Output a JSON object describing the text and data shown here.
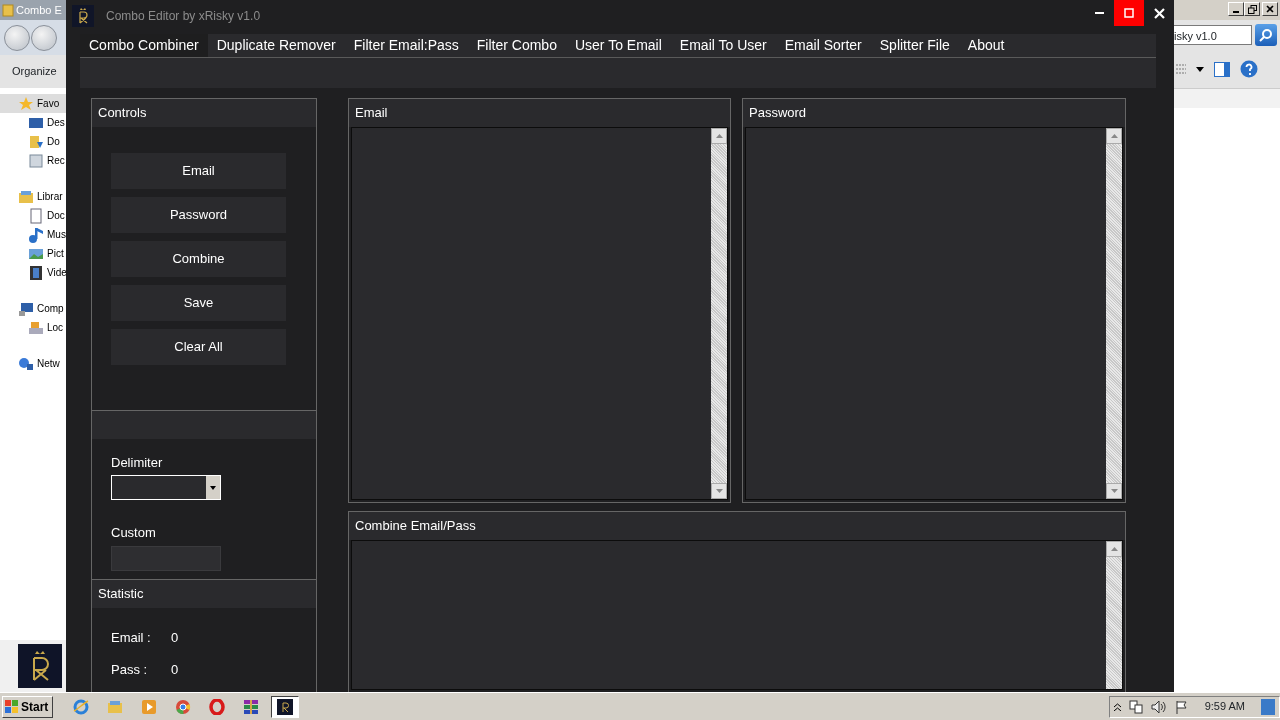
{
  "explorer": {
    "title": "Combo E",
    "toolbar": "Organize",
    "search_value": "isky v1.0",
    "sidebar": [
      {
        "label": "Favo",
        "selected": true,
        "children": [
          {
            "label": "Des",
            "selected": false
          },
          {
            "label": "Do",
            "selected": false
          },
          {
            "label": "Rec",
            "selected": false
          }
        ]
      },
      {
        "label": "Librar",
        "selected": false,
        "children": [
          {
            "label": "Doc",
            "selected": false
          },
          {
            "label": "Mus",
            "selected": false
          },
          {
            "label": "Pict",
            "selected": false
          },
          {
            "label": "Vide",
            "selected": false
          }
        ]
      },
      {
        "label": "Comp",
        "selected": false,
        "children": [
          {
            "label": "Loc",
            "selected": false
          }
        ]
      },
      {
        "label": "Netw",
        "selected": false
      }
    ]
  },
  "app": {
    "title": "Combo Editor by xRisky v1.0",
    "maximize_hovered": true,
    "menu": [
      {
        "label": "Combo Combiner",
        "selected": true
      },
      {
        "label": "Duplicate Remover",
        "selected": false
      },
      {
        "label": "Filter Email:Pass",
        "selected": false
      },
      {
        "label": "Filter Combo",
        "selected": false
      },
      {
        "label": "User To Email",
        "selected": false
      },
      {
        "label": "Email To User",
        "selected": false
      },
      {
        "label": "Email Sorter",
        "selected": false
      },
      {
        "label": "Splitter File",
        "selected": false
      },
      {
        "label": "About",
        "selected": false
      }
    ],
    "controls": {
      "title": "Controls",
      "buttons": [
        "Email",
        "Password",
        "Combine",
        "Save",
        "Clear All"
      ]
    },
    "delimiter": {
      "label": "Delimiter"
    },
    "custom": {
      "label": "Custom"
    },
    "statistic": {
      "title": "Statistic",
      "rows": [
        {
          "label": "Email :",
          "value": "0"
        },
        {
          "label": "Pass :",
          "value": "0"
        }
      ]
    },
    "panes": [
      {
        "title": "Email"
      },
      {
        "title": "Password"
      },
      {
        "title": "Combine Email/Pass"
      }
    ]
  },
  "taskbar": {
    "start": "Start",
    "clock": "9:59 AM",
    "apps": [
      {
        "kind": "ie",
        "selected": false
      },
      {
        "kind": "folder",
        "selected": false
      },
      {
        "kind": "media",
        "selected": false
      },
      {
        "kind": "chrome",
        "selected": false
      },
      {
        "kind": "opera",
        "selected": false
      },
      {
        "kind": "archive",
        "selected": false
      },
      {
        "kind": "app",
        "selected": true
      }
    ]
  }
}
